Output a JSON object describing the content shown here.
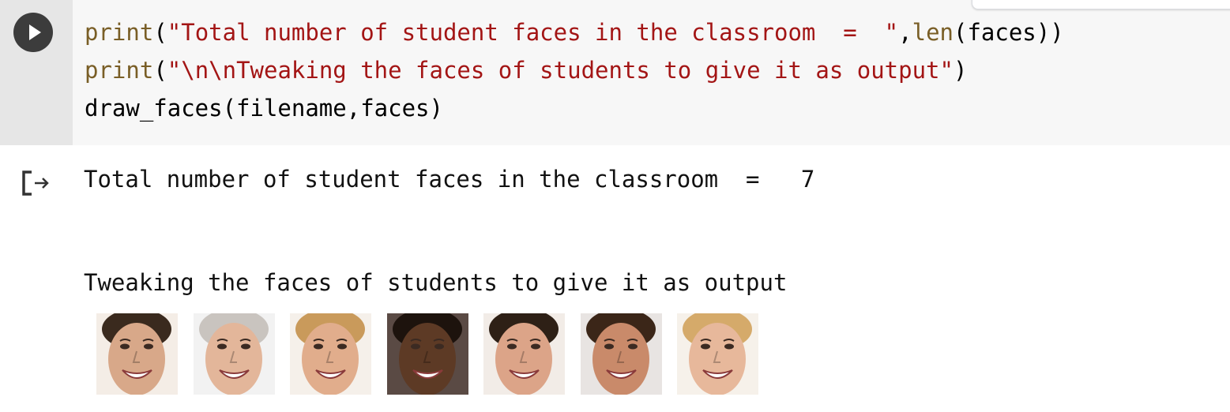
{
  "cell": {
    "code_lines": [
      {
        "fn": "print",
        "open": "(",
        "string": "\"Total number of student faces in the classroom  =  \"",
        "rest_fn": "len",
        "rest": "(faces))",
        "sep": ","
      },
      {
        "fn": "print",
        "open": "(",
        "string": "\"\\n\\nTweaking the faces of students to give it as output\"",
        "close": ")"
      },
      {
        "plain": "draw_faces(filename,faces)"
      }
    ]
  },
  "output": {
    "line1": "Total number of student faces in the classroom  =   7",
    "line2": "Tweaking the faces of students to give it as output",
    "faces": [
      {
        "name": "face-1",
        "skin": "#d8a889",
        "hair": "#3a2a1e",
        "bg": "#f4ede6"
      },
      {
        "name": "face-2",
        "skin": "#e3b69a",
        "hair": "#c9c4bf",
        "bg": "#f2f2f2"
      },
      {
        "name": "face-3",
        "skin": "#e1ad8c",
        "hair": "#c99a5b",
        "bg": "#f5f0ea"
      },
      {
        "name": "face-4",
        "skin": "#5d3a25",
        "hair": "#1d130d",
        "bg": "#5a4a44"
      },
      {
        "name": "face-5",
        "skin": "#dca488",
        "hair": "#2e2016",
        "bg": "#f2ece7"
      },
      {
        "name": "face-6",
        "skin": "#c98a6a",
        "hair": "#3b2618",
        "bg": "#e8e4e2"
      },
      {
        "name": "face-7",
        "skin": "#e7b89b",
        "hair": "#d5aa6a",
        "bg": "#f6f1ea"
      }
    ]
  }
}
